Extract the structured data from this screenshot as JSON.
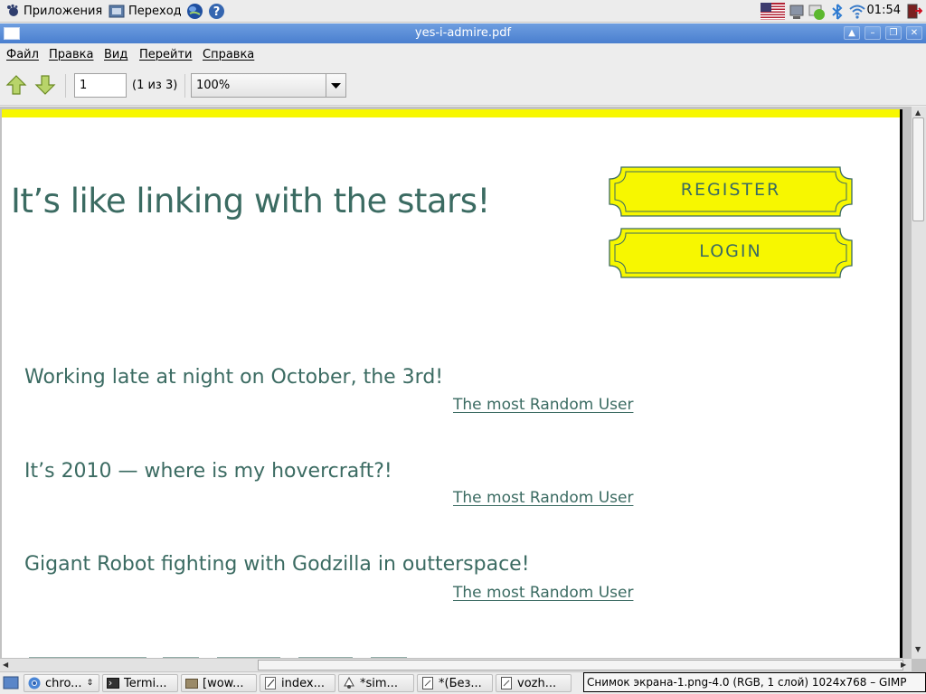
{
  "top_panel": {
    "applications_label": "Приложения",
    "places_label": "Переход",
    "clock": "01:54"
  },
  "window": {
    "title": "yes-i-admire.pdf"
  },
  "menubar": {
    "items": [
      "Файл",
      "Правка",
      "Вид",
      "Перейти",
      "Справка"
    ]
  },
  "toolbar": {
    "page_value": "1",
    "page_count": "(1 из 3)",
    "zoom": "100%"
  },
  "document": {
    "hero_title": "It’s like linking with the stars!",
    "register_label": "REGISTER",
    "login_label": "LOGIN",
    "posts": [
      {
        "text": "Working late at night on October, the 3rd!",
        "user": "The most Random User"
      },
      {
        "text": "It’s 2010 — where is my hovercraft?!",
        "user": "The most Random User"
      },
      {
        "text": "Gigant Robot fighting with Godzilla in outterspace!",
        "user": "The most Random User"
      }
    ]
  },
  "taskbar": {
    "items": [
      "chro...",
      "Termi...",
      "[wow...",
      "index...",
      "*sim...",
      "*(Без...",
      "vozh..."
    ]
  },
  "tooltip": "Снимок экрана-1.png-4.0 (RGB, 1 слой) 1024x768 – GIMP",
  "colors": {
    "accent_yellow": "#f7f700",
    "text_green": "#3b6b62",
    "titlebar_blue": "#4a7fcf"
  }
}
